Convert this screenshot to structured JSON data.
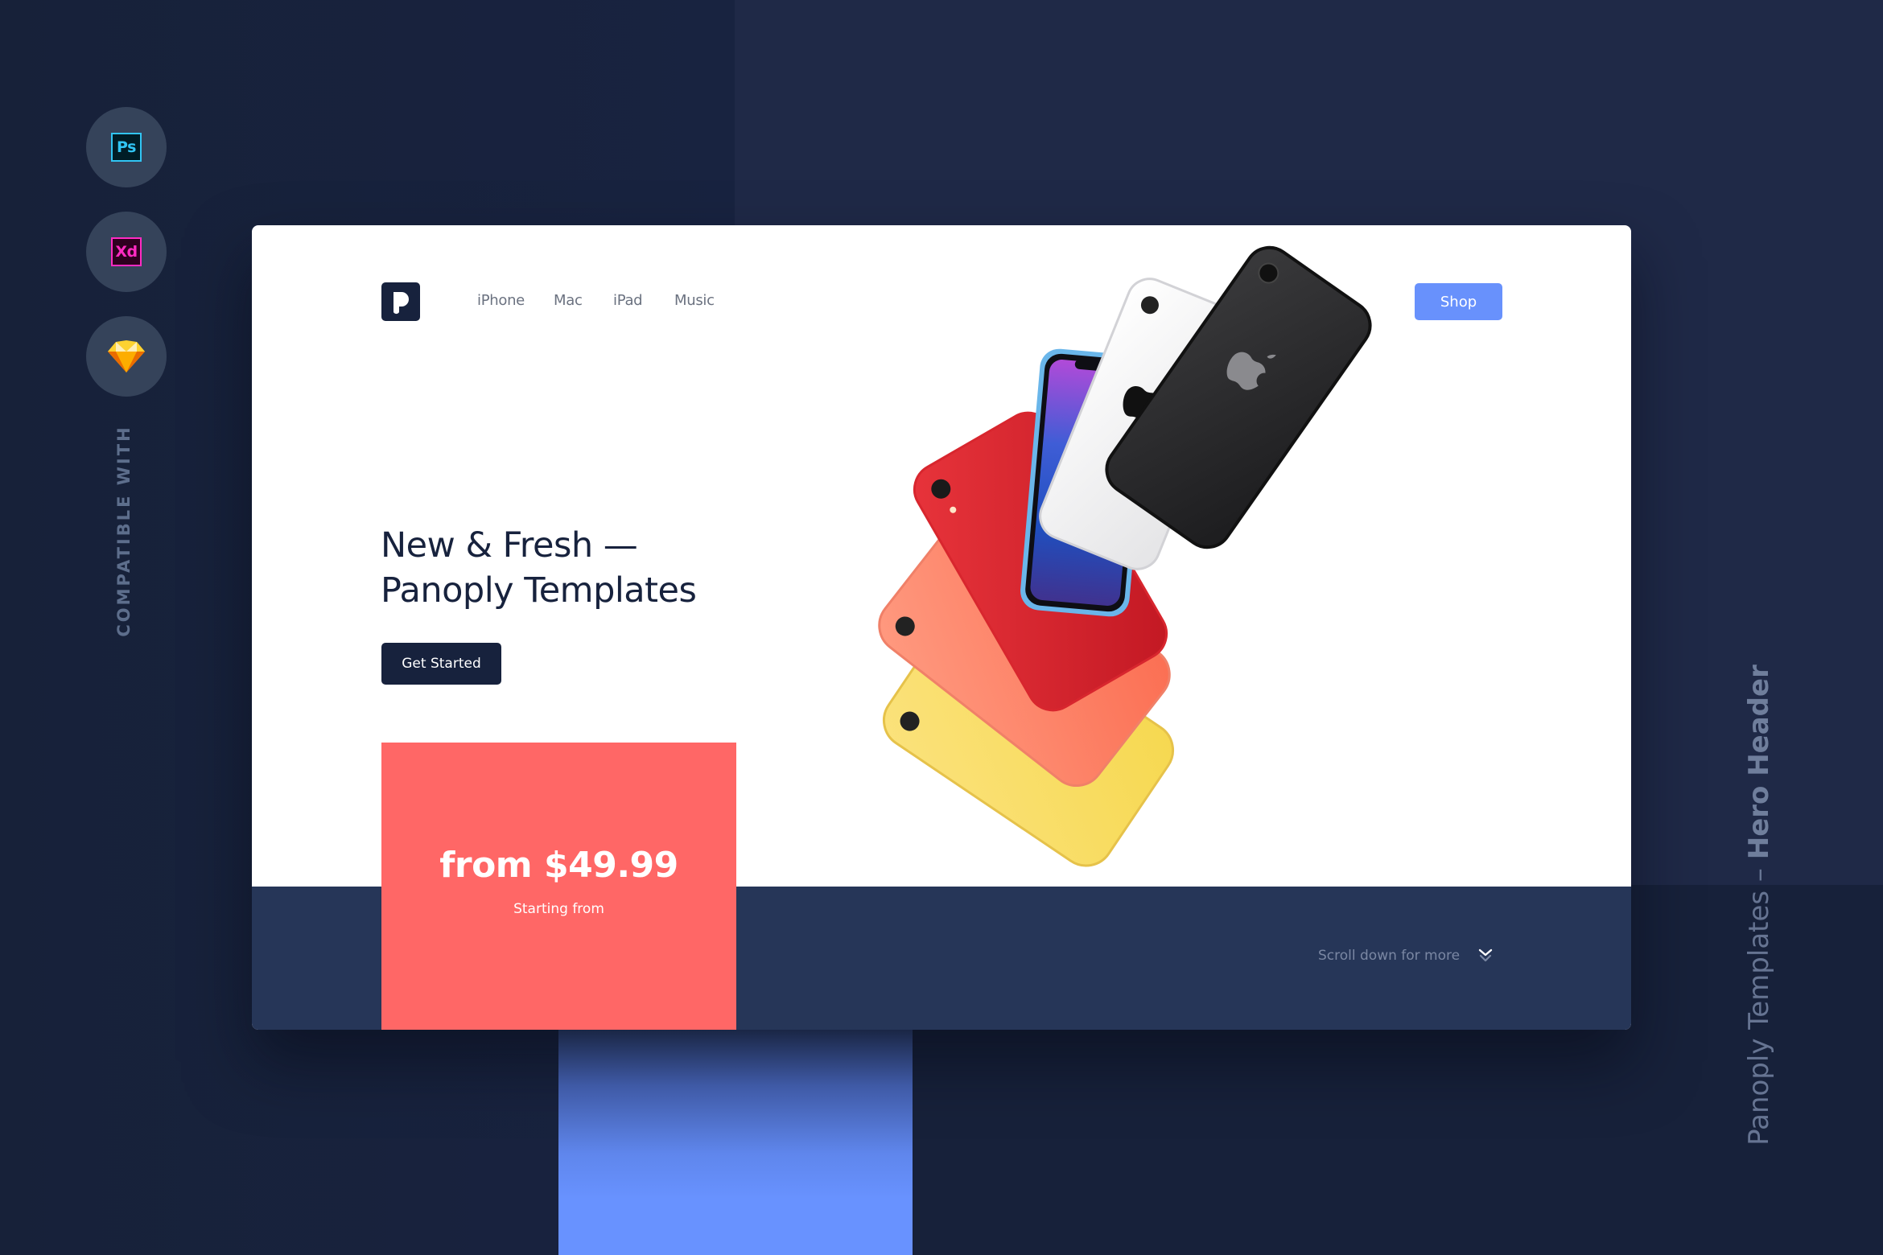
{
  "colors": {
    "background": "#17213a",
    "background_panel": "#1f2947",
    "card": "#ffffff",
    "card_band": "#263658",
    "primary_dark": "#17223d",
    "accent_blue": "#6891fc",
    "coral": "#ff6766",
    "rail_circle": "#35435a",
    "muted_text": "#6b7280"
  },
  "compatibility": {
    "label": "COMPATIBLE WITH",
    "apps": [
      {
        "name": "Photoshop",
        "icon": "photoshop-icon",
        "glyph": "Ps"
      },
      {
        "name": "Adobe XD",
        "icon": "xd-icon",
        "glyph": "Xd"
      },
      {
        "name": "Sketch",
        "icon": "sketch-diamond-icon",
        "glyph": ""
      }
    ]
  },
  "header": {
    "logo_icon": "panoply-logo-icon",
    "nav": [
      {
        "label": "iPhone"
      },
      {
        "label": "Mac"
      },
      {
        "label": "iPad"
      },
      {
        "label": "Music"
      }
    ],
    "shop_label": "Shop"
  },
  "hero": {
    "title_line1": "New & Fresh —",
    "title_line2": "Panoply Templates",
    "cta_label": "Get Started",
    "image": "iphone-xr-color-fan",
    "phone_colors": [
      "yellow",
      "coral",
      "red",
      "blue",
      "white",
      "black"
    ]
  },
  "pricing": {
    "price": "from $49.99",
    "caption": "Starting from"
  },
  "scroll_hint": {
    "label": "Scroll down for more",
    "icon": "double-chevron-down-icon"
  },
  "side_caption": {
    "prefix": "Panoply Templates – ",
    "emphasis": "Hero Header"
  }
}
